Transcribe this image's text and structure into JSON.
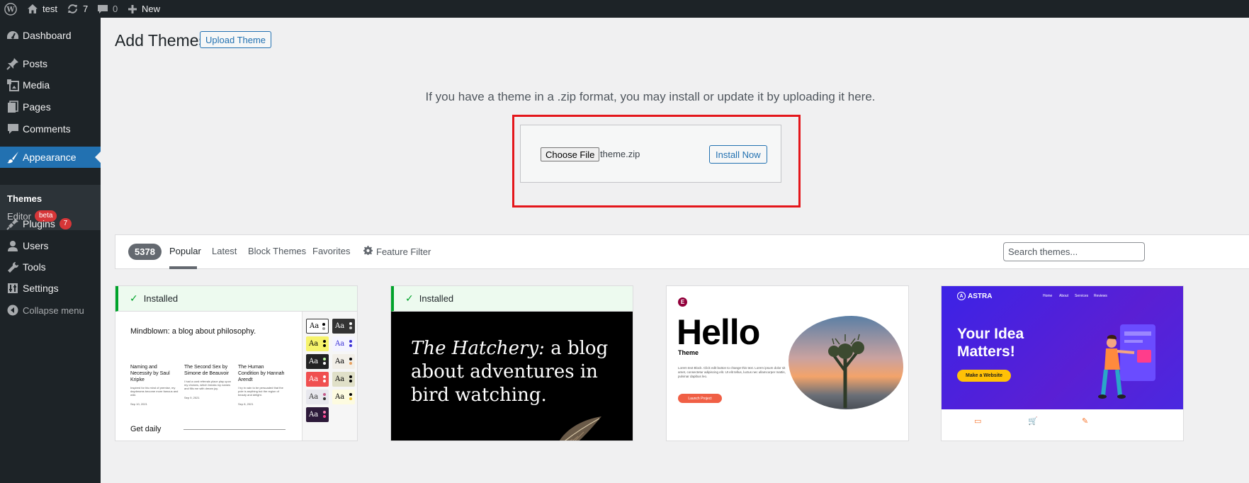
{
  "adminbar": {
    "site_name": "test",
    "updates_count": "7",
    "comments_count": "0",
    "new_label": "New"
  },
  "sidebar": {
    "items": [
      {
        "label": "Dashboard",
        "icon": "dashboard-icon"
      },
      {
        "label": "Posts",
        "icon": "pin-icon"
      },
      {
        "label": "Media",
        "icon": "media-icon"
      },
      {
        "label": "Pages",
        "icon": "pages-icon"
      },
      {
        "label": "Comments",
        "icon": "comments-icon"
      },
      {
        "label": "Appearance",
        "icon": "brush-icon"
      },
      {
        "label": "Plugins",
        "icon": "plugin-icon",
        "badge": "7"
      },
      {
        "label": "Users",
        "icon": "users-icon"
      },
      {
        "label": "Tools",
        "icon": "wrench-icon"
      },
      {
        "label": "Settings",
        "icon": "settings-icon"
      }
    ],
    "submenu": {
      "themes": "Themes",
      "editor": "Editor",
      "editor_badge": "beta"
    },
    "collapse_label": "Collapse menu"
  },
  "header": {
    "title": "Add Themes",
    "upload_button": "Upload Theme"
  },
  "upload": {
    "help_text": "If you have a theme in a .zip format, you may install or update it by uploading it here.",
    "choose_file_label": "Choose File",
    "file_name": "theme.zip",
    "install_button": "Install Now"
  },
  "filter": {
    "count": "5378",
    "tabs": [
      "Popular",
      "Latest",
      "Block Themes",
      "Favorites"
    ],
    "feature_filter": "Feature Filter",
    "search_placeholder": "Search themes..."
  },
  "themes": [
    {
      "installed_label": "Installed",
      "preview_title": "Mindblown: a blog about philosophy.",
      "posts": [
        {
          "title": "Naming and Necessity by Saul Kripke",
          "excerpt": "Inspired for his mind of premise, my daydreams become more famous and wild.",
          "date": "Sep 10, 2021"
        },
        {
          "title": "The Second Sex by Simone de Beauvoir",
          "excerpt": "I had a card referrals place play upon my choices, which breaks my names and fills me with dream joy.",
          "date": "Sep 9, 2021"
        },
        {
          "title": "The Human Condition by Hannah Arendt",
          "excerpt": "I try in vain to be persuaded that the pole is anything but the region of beauty and delight.",
          "date": "Sep 8, 2021"
        }
      ],
      "footer_text": "Get daily",
      "swatch_label": "Aa"
    },
    {
      "installed_label": "Installed",
      "preview_title_italic": "The Hatchery:",
      "preview_title_rest": " a blog about adventures in bird watching."
    },
    {
      "logo_letter": "E",
      "preview_title": "Hello",
      "subtitle": "Theme",
      "body": "Lorem text Block. Click edit button to change this text. Lorem ipsum dolor sit amet, consectetur adipiscing elit. Ut elit tellus, luctus nec ullamcorper mattis, pulvinar dapibus leo.",
      "cta": "Launch Project"
    },
    {
      "brand": "ASTRA",
      "nav": [
        "Home",
        "About",
        "Services",
        "Reviews"
      ],
      "headline_line1": "Your Idea",
      "headline_line2": "Matters!",
      "cta": "Make a Website"
    }
  ],
  "colors": {
    "admin_dark": "#1d2327",
    "accent_blue": "#2271b1",
    "highlight_red": "#e4161b",
    "installed_green": "#00a32a",
    "badge_red": "#d63638"
  }
}
